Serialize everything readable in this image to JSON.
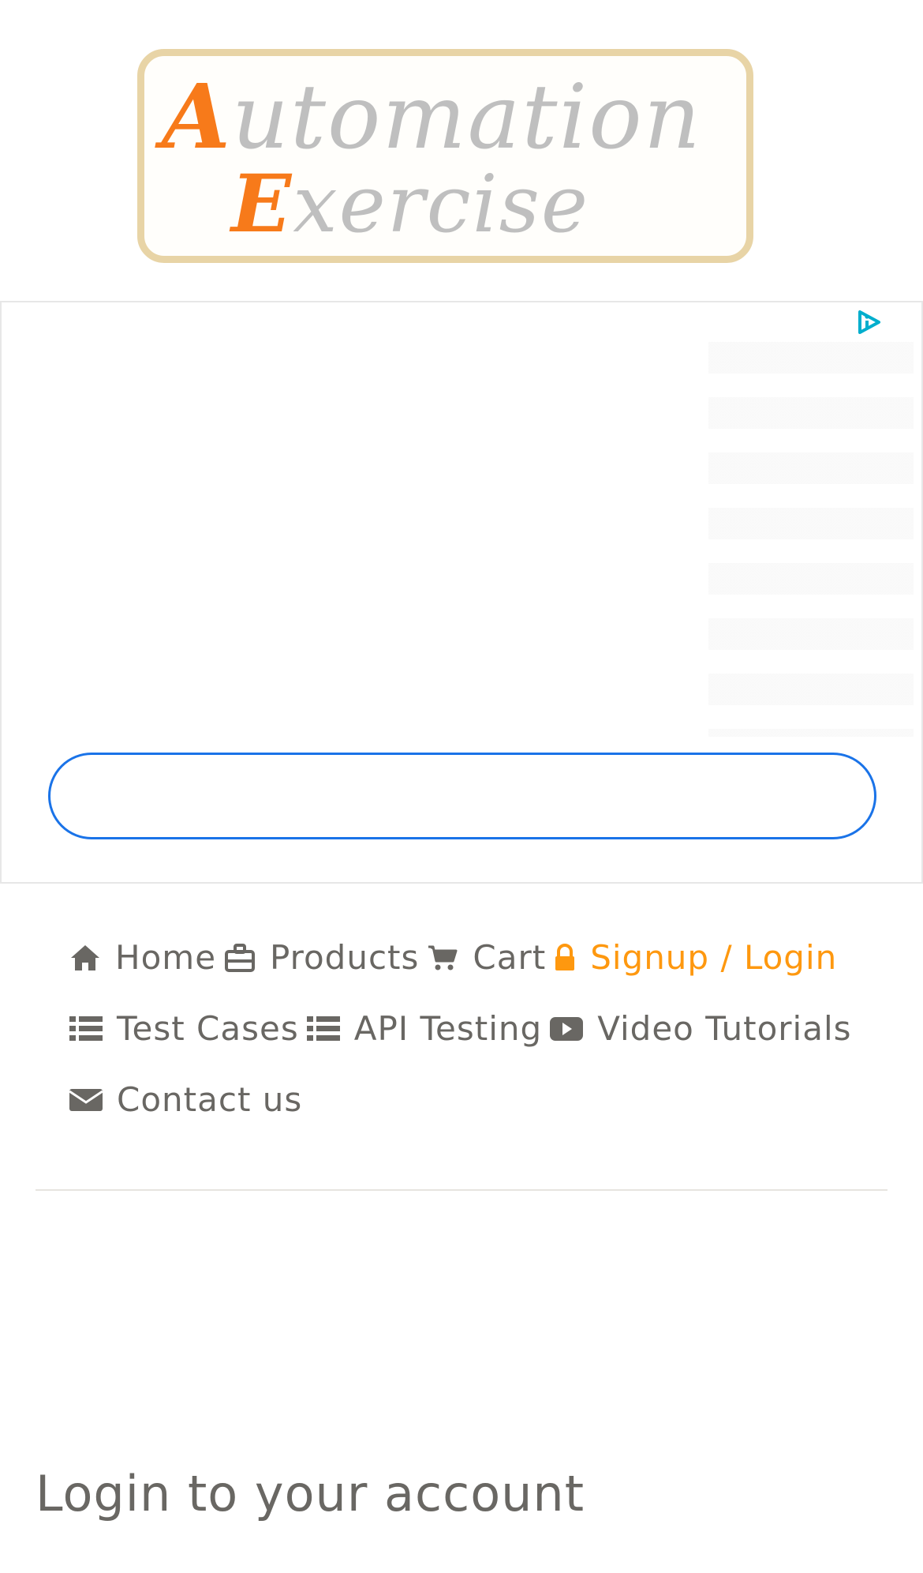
{
  "logo": {
    "line1_cap": "A",
    "line1_rest": "utomation",
    "line2_cap": "E",
    "line2_rest": "xercise",
    "colors": {
      "accent": "#f77a1a",
      "gray": "#bfbfbf",
      "border": "#e8d4a6"
    }
  },
  "ad": {
    "badge_icon": "adchoices-icon",
    "button_label": "",
    "colors": {
      "button_border": "#1a73e8"
    }
  },
  "nav": {
    "items": [
      {
        "label": "Home",
        "icon": "home-icon"
      },
      {
        "label": "Products",
        "icon": "products-icon"
      },
      {
        "label": "Cart",
        "icon": "cart-icon"
      },
      {
        "label": "Signup / Login",
        "icon": "lock-icon",
        "active": true
      },
      {
        "label": "Test Cases",
        "icon": "list-icon"
      },
      {
        "label": "API Testing",
        "icon": "list-icon"
      },
      {
        "label": "Video Tutorials",
        "icon": "youtube-play-icon"
      },
      {
        "label": "Contact us",
        "icon": "envelope-icon"
      }
    ],
    "colors": {
      "text": "#696763",
      "active": "#fe980f"
    }
  },
  "login": {
    "title": "Login to your account"
  }
}
